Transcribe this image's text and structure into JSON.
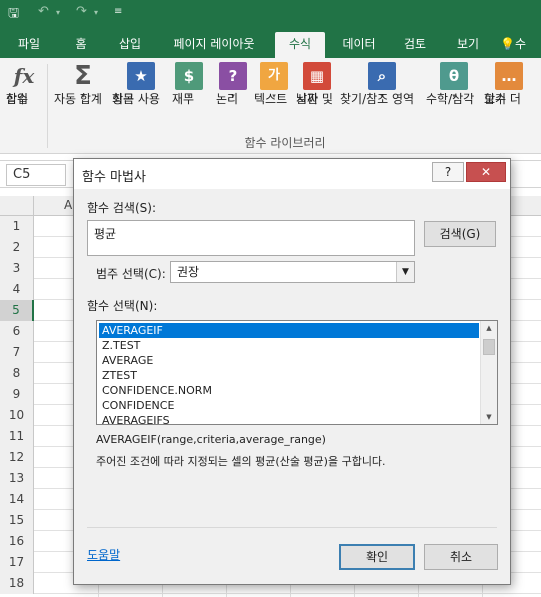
{
  "quick_access": {
    "save_icon": "save-icon",
    "undo_icon": "undo-icon",
    "redo_icon": "redo-icon",
    "customize_icon": "customize-qat-icon"
  },
  "tabs": [
    {
      "label": "파일"
    },
    {
      "label": "홈"
    },
    {
      "label": "삽입"
    },
    {
      "label": "페이지 레이아웃"
    },
    {
      "label": "수식"
    },
    {
      "label": "데이터"
    },
    {
      "label": "검토"
    },
    {
      "label": "보기"
    }
  ],
  "tell_me": "수",
  "ribbon": {
    "insert_function": {
      "line1": "함수",
      "line2": "삽입",
      "icon": "fx"
    },
    "autosum": {
      "label": "자동 합계",
      "icon": "Σ"
    },
    "recent": {
      "line1": "최근 사용",
      "line2": "항목",
      "icon": "★"
    },
    "financial": {
      "label": "재무",
      "icon": "$"
    },
    "logical": {
      "label": "논리",
      "icon": "?"
    },
    "text": {
      "label": "텍스트",
      "icon": "가"
    },
    "datetime": {
      "line1": "날짜 및",
      "line2": "시간",
      "icon": "▦"
    },
    "lookup": {
      "label": "찾기/참조 영역",
      "icon": "⌕"
    },
    "math": {
      "label": "수학/삼각",
      "icon": "θ"
    },
    "more": {
      "line1": "함수 더",
      "line2": "보기",
      "icon": "…"
    },
    "group_label": "함수 라이브러리"
  },
  "formula_bar": {
    "name_box": "C5"
  },
  "sheet": {
    "columns": [
      "A"
    ],
    "rows": [
      "1",
      "2",
      "3",
      "4",
      "5",
      "6",
      "7",
      "8",
      "9",
      "10",
      "11",
      "12",
      "13",
      "14",
      "15",
      "16",
      "17",
      "18"
    ],
    "selected_row": "5"
  },
  "dialog": {
    "title": "함수 마법사",
    "help_btn": "?",
    "close_btn": "✕",
    "search_label": "함수 검색(S):",
    "search_value": "평균",
    "search_button": "검색(G)",
    "category_label": "범주 선택(C):",
    "category_value": "권장",
    "function_label": "함수 선택(N):",
    "functions": [
      {
        "name": "AVERAGEIF"
      },
      {
        "name": "Z.TEST"
      },
      {
        "name": "AVERAGE"
      },
      {
        "name": "ZTEST"
      },
      {
        "name": "CONFIDENCE.NORM"
      },
      {
        "name": "CONFIDENCE"
      },
      {
        "name": "AVERAGEIFS"
      }
    ],
    "selected_function": "AVERAGEIF",
    "syntax": "AVERAGEIF(range,criteria,average_range)",
    "description": "주어진 조건에 따라 지정되는 셀의 평균(산술 평균)을 구합니다.",
    "help_link": "도움말",
    "ok_button": "확인",
    "cancel_button": "취소"
  }
}
